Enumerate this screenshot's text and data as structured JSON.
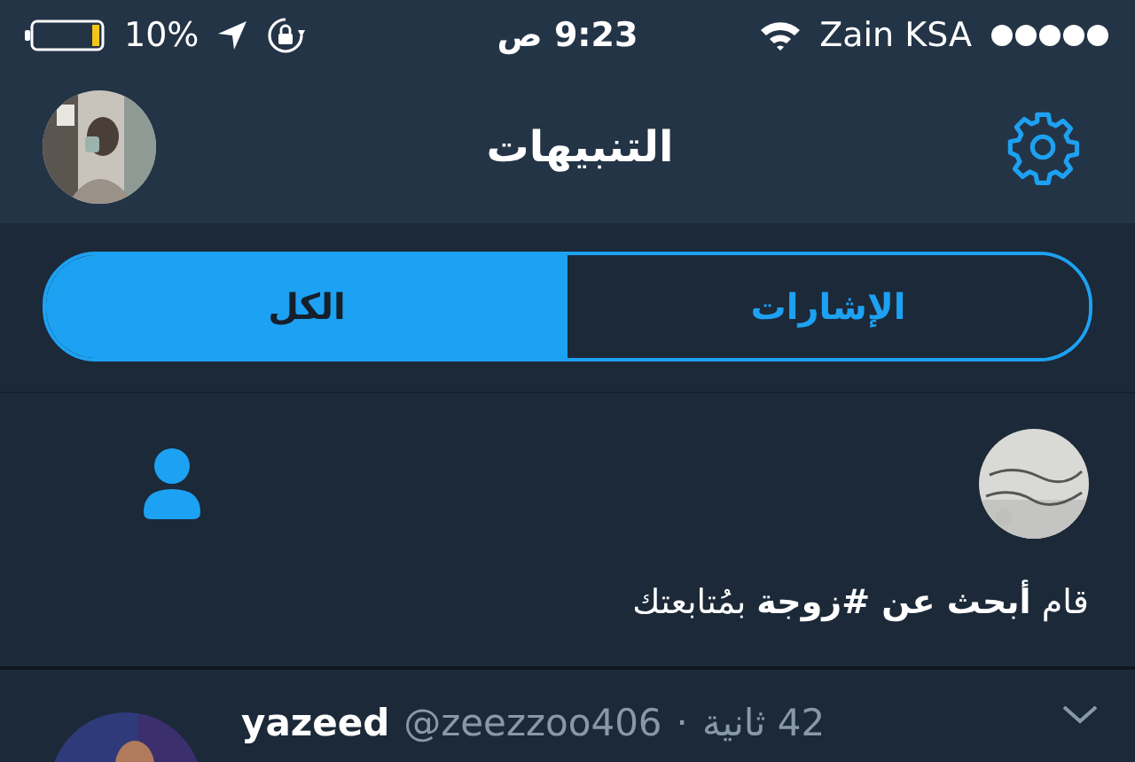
{
  "status_bar": {
    "battery": "10%",
    "time": "9:23 ص",
    "carrier": "Zain KSA"
  },
  "nav": {
    "title": "التنبيهات"
  },
  "tabs": [
    {
      "label": "الإشارات",
      "selected": false
    },
    {
      "label": "الكل",
      "selected": true
    }
  ],
  "notification": {
    "text": "قام **أبحث عن #زوجة** بمُتابعتك"
  },
  "tweet": {
    "name": "yazeed",
    "handle": "@zeezzoo406",
    "separator": "·",
    "time": "42 ثانية"
  }
}
